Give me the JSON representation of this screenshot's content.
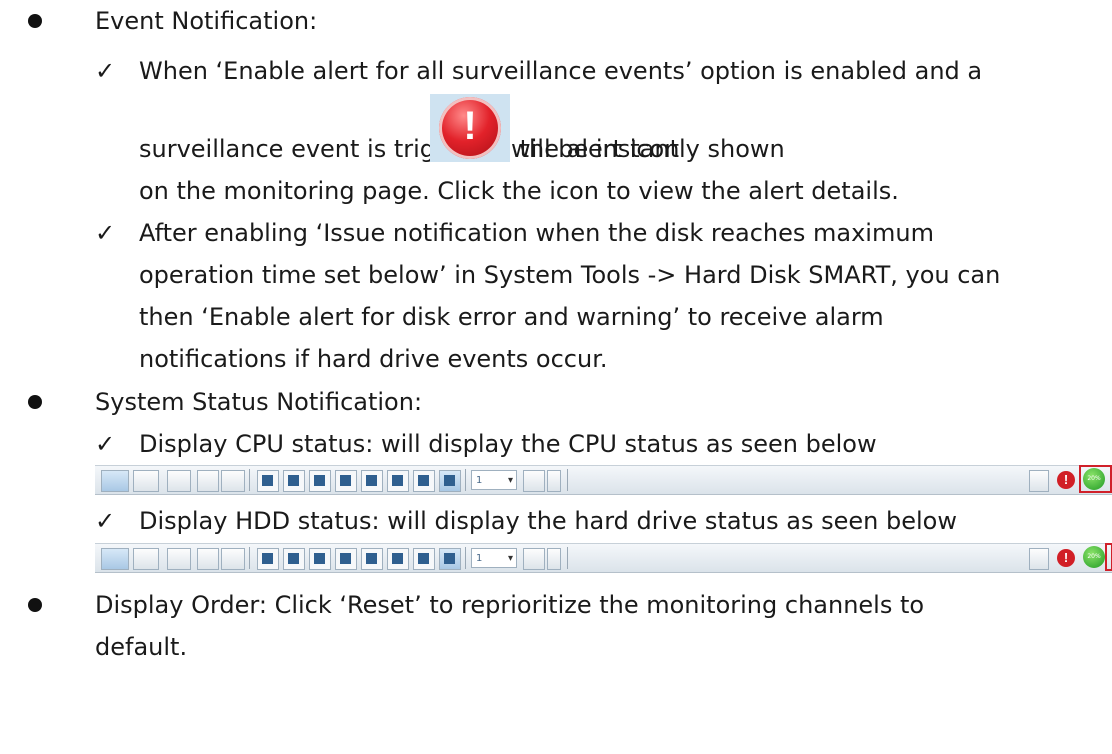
{
  "sections": {
    "event_notification": {
      "heading": "Event Notification:",
      "items": [
        {
          "lines": [
            "When ‘Enable alert for all surveillance events’ option is enabled and a",
            "surveillance event is triggered, the alert icon",
            "will be instantly shown",
            "on the monitoring page.    Click the icon to view the alert details."
          ]
        },
        {
          "lines": [
            "After enabling  ‘Issue notification when the disk reaches maximum",
            "operation time set below’    in System Tools -> Hard Disk SMART, you can",
            "then  ‘Enable alert for disk error and warning’    to receive alarm",
            "notifications if hard drive events occur."
          ]
        }
      ]
    },
    "system_status": {
      "heading": "System Status Notification:",
      "items": [
        {
          "text": "Display CPU status: will display the CPU status as seen below"
        },
        {
          "text": "Display HDD status: will display the hard drive status as seen below"
        }
      ]
    },
    "display_order": {
      "lines": [
        "Display Order: Click  ‘Reset’    to reprioritize the monitoring channels to",
        "default."
      ]
    }
  },
  "toolbar": {
    "channel_value": "1",
    "status_badge_text": "20%",
    "icons": [
      "monitor-icon",
      "play-icon",
      "clear-icon",
      "collapse-icon",
      "fullscreen-icon",
      "layout-1-icon",
      "layout-4-icon",
      "layout-9-icon",
      "layout-6-icon",
      "layout-16-icon",
      "layout-10-icon",
      "layout-13-icon",
      "layout-custom-icon",
      "sequence-icon",
      "snapshot-icon",
      "alert-icon",
      "status-icon"
    ]
  },
  "colors": {
    "alert_red": "#d11f26",
    "status_green": "#2aa52b",
    "highlight_frame": "#d0202a"
  }
}
